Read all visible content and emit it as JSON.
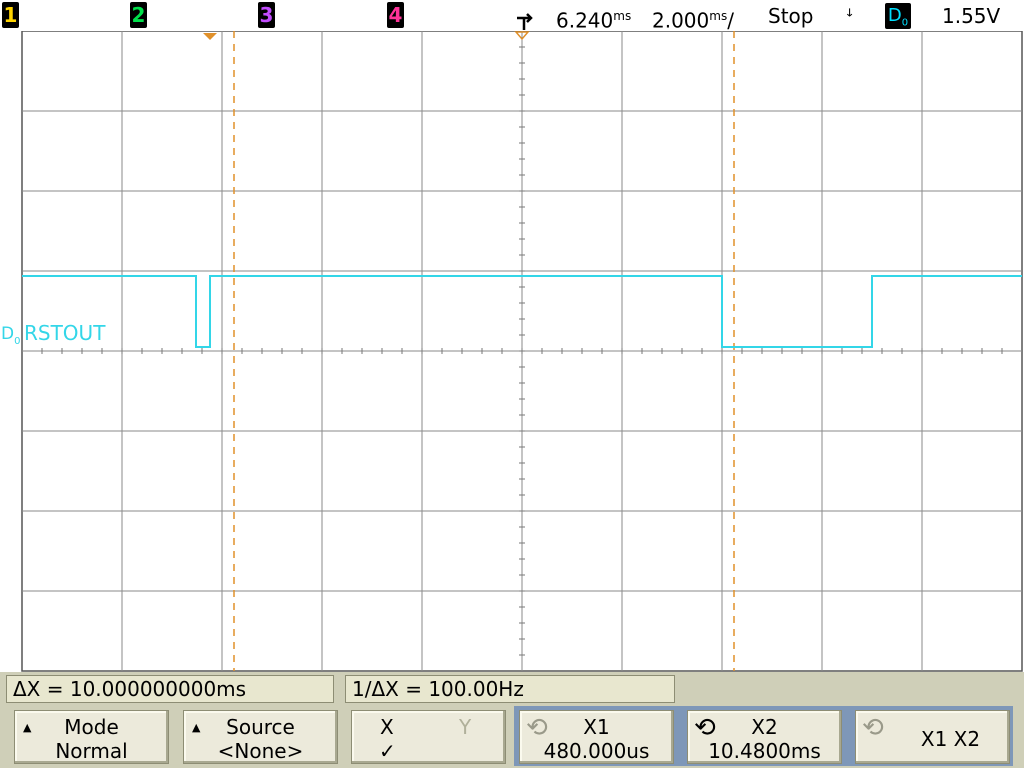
{
  "topbar": {
    "channels": [
      {
        "label": "1",
        "color": "#ffd400"
      },
      {
        "label": "2",
        "color": "#00e04a"
      },
      {
        "label": "3",
        "color": "#c34cff"
      },
      {
        "label": "4",
        "color": "#ff3399"
      }
    ],
    "delay": "6.240",
    "delay_unit": "ms",
    "timebase": "2.000",
    "timebase_unit": "ms",
    "timebase_suffix": "/",
    "run_state": "Stop",
    "trigger_slope": "ꜜ",
    "trigger_source": "D",
    "trigger_source_sub": "0",
    "trigger_level": "1.55V"
  },
  "trace": {
    "channel_label": "D",
    "channel_sub": "0",
    "name": "RSTOUT",
    "color": "#33d6e8",
    "time_per_div_ms": 2.0,
    "delay_ms": 6.24,
    "segments_ms": [
      {
        "from": -3.76,
        "to": -0.28,
        "level": "high"
      },
      {
        "from": -0.28,
        "to": 0.0,
        "level": "low"
      },
      {
        "from": 0.0,
        "to": 10.24,
        "level": "high"
      },
      {
        "from": 10.24,
        "to": 13.24,
        "level": "low"
      },
      {
        "from": 13.24,
        "to": 16.24,
        "level": "high"
      }
    ]
  },
  "cursors": {
    "x1_ms": 0.48,
    "x2_ms": 10.48,
    "color": "#e0902a"
  },
  "measurements": {
    "delta_x": "ΔX = 10.000000000ms",
    "inv_delta_x": "1/ΔX = 100.00Hz"
  },
  "softkeys": {
    "mode_label": "Mode",
    "mode_value": "Normal",
    "source_label": "Source",
    "source_value": "<None>",
    "x_label": "X",
    "y_label": "Y",
    "x_check": "✓",
    "x1_label": "X1",
    "x1_value": "480.000us",
    "x2_label": "X2",
    "x2_value": "10.4800ms",
    "x1x2_label": "X1 X2"
  }
}
